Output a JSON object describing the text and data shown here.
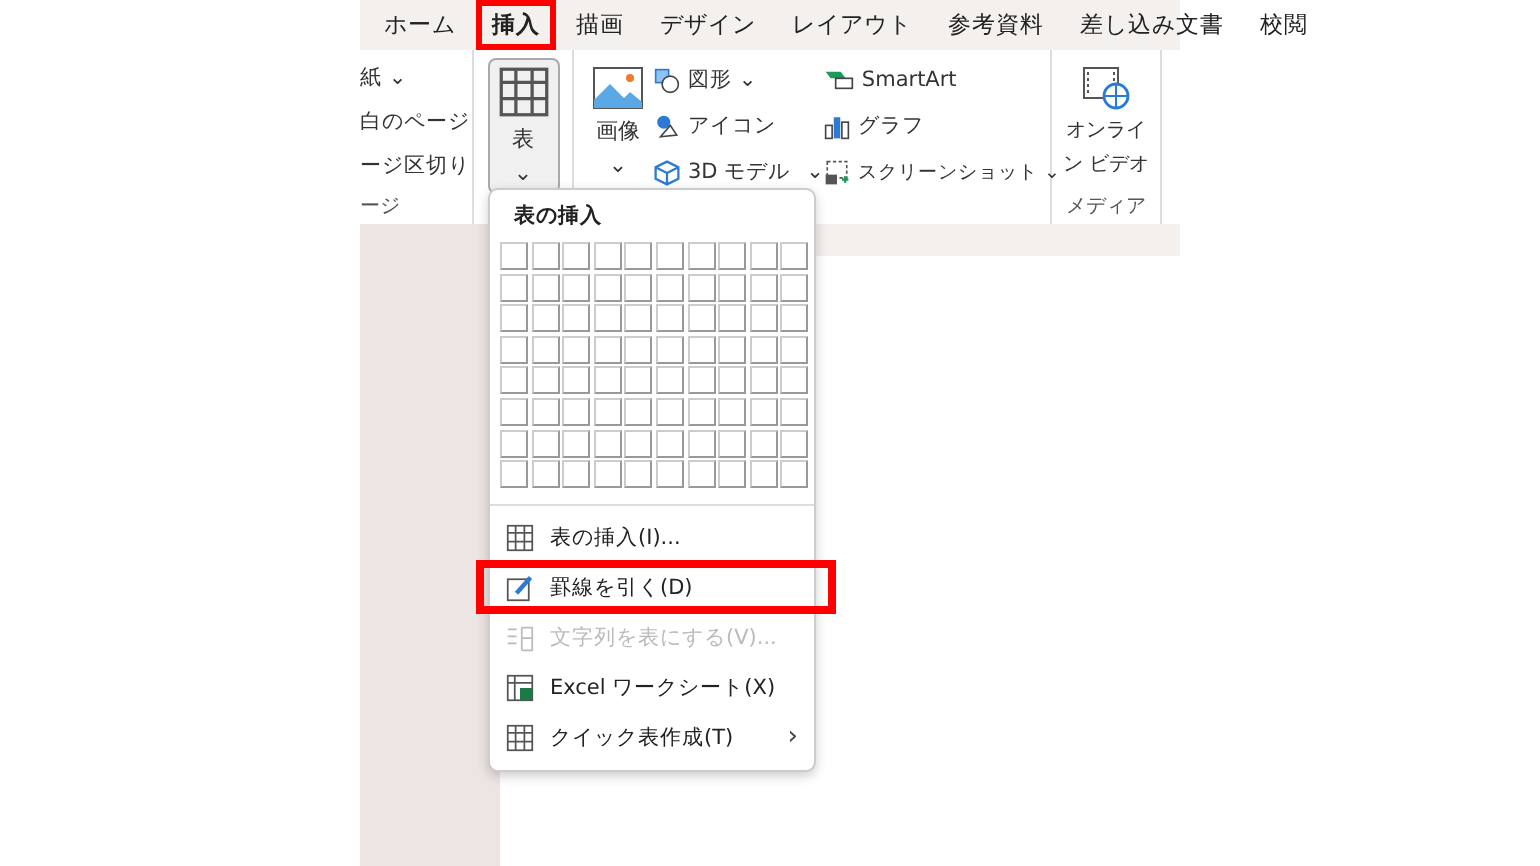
{
  "ribbon_tabs": [
    {
      "label": "ホーム",
      "selected": false,
      "highlighted": false
    },
    {
      "label": "挿入",
      "selected": true,
      "highlighted": true
    },
    {
      "label": "描画",
      "selected": false,
      "highlighted": false
    },
    {
      "label": "デザイン",
      "selected": false,
      "highlighted": false
    },
    {
      "label": "レイアウト",
      "selected": false,
      "highlighted": false
    },
    {
      "label": "参考資料",
      "selected": false,
      "highlighted": false
    },
    {
      "label": "差し込み文書",
      "selected": false,
      "highlighted": false
    },
    {
      "label": "校閲",
      "selected": false,
      "highlighted": false
    }
  ],
  "pages_group": {
    "items": [
      "紙 ⌄",
      "白のページ",
      "ージ区切り"
    ],
    "label": "ージ"
  },
  "table_button": {
    "label": "表",
    "caret": "⌄"
  },
  "picture_button": {
    "label": "画像",
    "caret": "⌄"
  },
  "illustrations": [
    {
      "kind": "shapes",
      "label": "図形 ⌄"
    },
    {
      "kind": "icons",
      "label": "アイコン"
    },
    {
      "kind": "model",
      "label": "3D モデル",
      "caret": "⌄"
    }
  ],
  "graphics": [
    {
      "kind": "smartart",
      "label": "SmartArt"
    },
    {
      "kind": "chart",
      "label": "グラフ"
    },
    {
      "kind": "screenshot",
      "label": "スクリーンショット ⌄"
    }
  ],
  "media_group": {
    "button_lines": [
      "オンライ",
      "ン ビデオ"
    ],
    "label": "メディア"
  },
  "table_menu": {
    "title": "表の挿入",
    "items": [
      {
        "kind": "table",
        "label": "表の挿入(I)...",
        "disabled": false,
        "highlighted": false
      },
      {
        "kind": "draw",
        "label": "罫線を引く(D)",
        "disabled": false,
        "highlighted": true
      },
      {
        "kind": "convert",
        "label": "文字列を表にする(V)...",
        "disabled": true,
        "highlighted": false
      },
      {
        "kind": "excel",
        "label": "Excel ワークシート(X)",
        "disabled": false,
        "highlighted": false
      },
      {
        "kind": "quick",
        "label": "クイック表作成(T)",
        "disabled": false,
        "highlighted": false,
        "submenu": "›"
      }
    ]
  }
}
